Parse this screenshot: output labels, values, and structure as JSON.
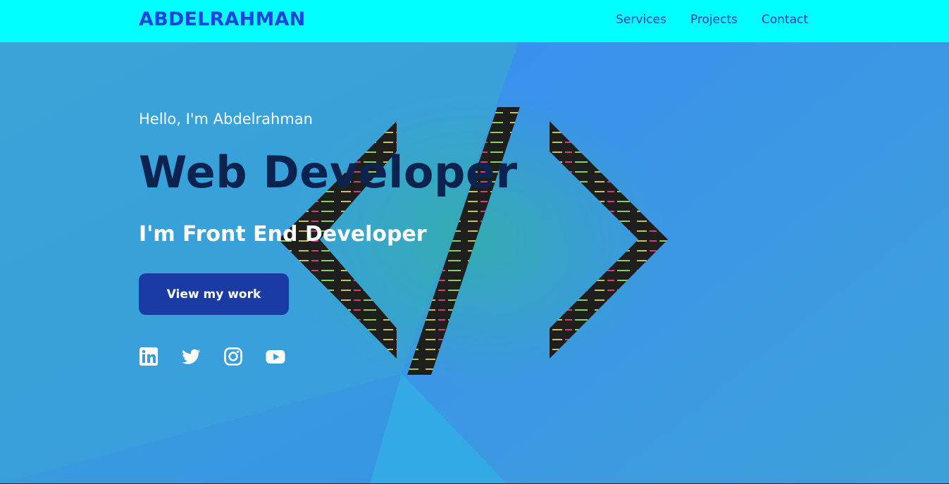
{
  "navbar": {
    "brand": "ABDELRAHMAN",
    "links": [
      "Services",
      "Projects",
      "Contact"
    ]
  },
  "hero": {
    "greeting": "Hello, I'm Abdelrahman",
    "headline": "Web Developer",
    "subtitle": "I'm Front End Developer",
    "cta_label": "View my work"
  },
  "socials": [
    {
      "icon": "linkedin-icon"
    },
    {
      "icon": "twitter-icon"
    },
    {
      "icon": "instagram-icon"
    },
    {
      "icon": "youtube-icon"
    }
  ],
  "colors": {
    "navbar_bg": "#00ffff",
    "brand": "#1a44e0",
    "nav_link": "#1a3fc2",
    "headline": "#0c2350",
    "cta_bg": "#1a3ba3",
    "hero_bg": "#3a9bd8"
  }
}
